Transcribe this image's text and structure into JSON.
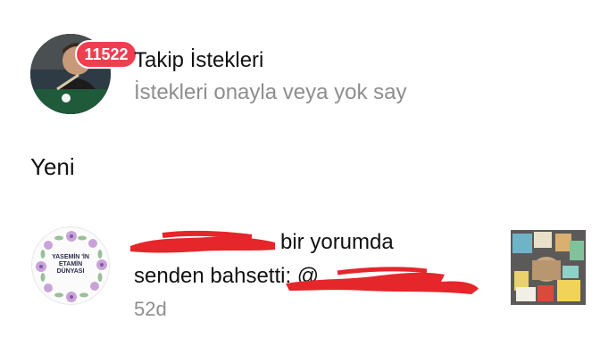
{
  "requests": {
    "badge_count": "11522",
    "title": "Takip İstekleri",
    "subtitle": "İstekleri onayla veya yok say"
  },
  "section": {
    "title": "Yeni"
  },
  "notification": {
    "avatar_logo_lines": [
      "YASEMİN 'İN",
      "ETAMİN",
      "DÜNYASI"
    ],
    "line1_visible": "bir yorumda",
    "line2_visible": "senden bahsetti: @",
    "time": "52d"
  },
  "colors": {
    "badge": "#ef3e50",
    "redaction": "#e5262b",
    "secondary_text": "#8e8e8e"
  }
}
